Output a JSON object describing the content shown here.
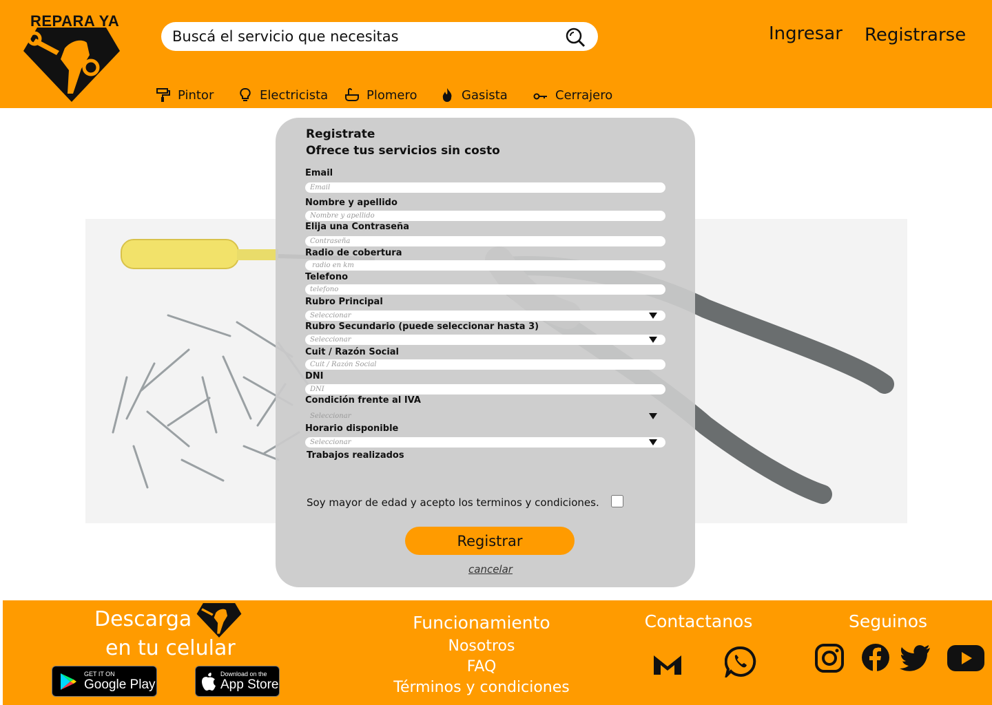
{
  "header": {
    "logo_text": "REPARA YA",
    "search_placeholder": "Buscá el servicio que necesitas",
    "login": "Ingresar",
    "register": "Registrarse",
    "categories": [
      {
        "label": "Pintor",
        "icon": "paint-roller-icon"
      },
      {
        "label": "Electricista",
        "icon": "light-bulb-icon"
      },
      {
        "label": "Plomero",
        "icon": "bathtub-icon"
      },
      {
        "label": "Gasista",
        "icon": "flame-icon"
      },
      {
        "label": "Cerrajero",
        "icon": "key-icon"
      }
    ]
  },
  "form": {
    "title": "Registrate",
    "subtitle": "Ofrece tus servicios sin costo",
    "fields": [
      {
        "label": "Email",
        "placeholder": "Email"
      },
      {
        "label": "Nombre y apellido",
        "placeholder": "Nombre y apellido"
      },
      {
        "label": "Elija una Contraseña",
        "placeholder": "Contraseña"
      },
      {
        "label": "Radio de cobertura",
        "placeholder": " radio en km"
      },
      {
        "label": "Telefono",
        "placeholder": "telefono"
      },
      {
        "label": "Rubro Principal",
        "placeholder": "Seleccionar"
      },
      {
        "label": "Rubro Secundario (puede seleccionar hasta 3)",
        "placeholder": "Seleccionar"
      },
      {
        "label": "Cuit / Razón Social",
        "placeholder": "Cuit / Razón Social"
      },
      {
        "label": "DNI",
        "placeholder": "DNI"
      },
      {
        "label": "Condición frente al IVA",
        "placeholder": "Seleccionar"
      },
      {
        "label": "Horario disponible",
        "placeholder": "Seleccionar"
      },
      {
        "label": "Trabajos realizados"
      }
    ],
    "terms": "Soy mayor de edad y acepto los terminos y condiciones.",
    "submit": "Registrar",
    "cancel": "cancelar"
  },
  "footer": {
    "download_line1": "Descarga",
    "download_line2": "en tu celular",
    "google_small": "GET IT ON",
    "google_big": "Google Play",
    "apple_small": "Download on the",
    "apple_big": "App Store",
    "links_title": "Funcionamiento",
    "links": [
      "Nosotros",
      "FAQ",
      "Términos y condiciones"
    ],
    "contact_title": "Contactanos",
    "contact_icons": [
      "gmail-icon",
      "whatsapp-icon"
    ],
    "follow_title": "Seguinos",
    "follow_icons": [
      "instagram-icon",
      "facebook-icon",
      "twitter-icon",
      "youtube-icon"
    ]
  },
  "colors": {
    "brand": "#ff9b00",
    "card": "#cacaca"
  }
}
